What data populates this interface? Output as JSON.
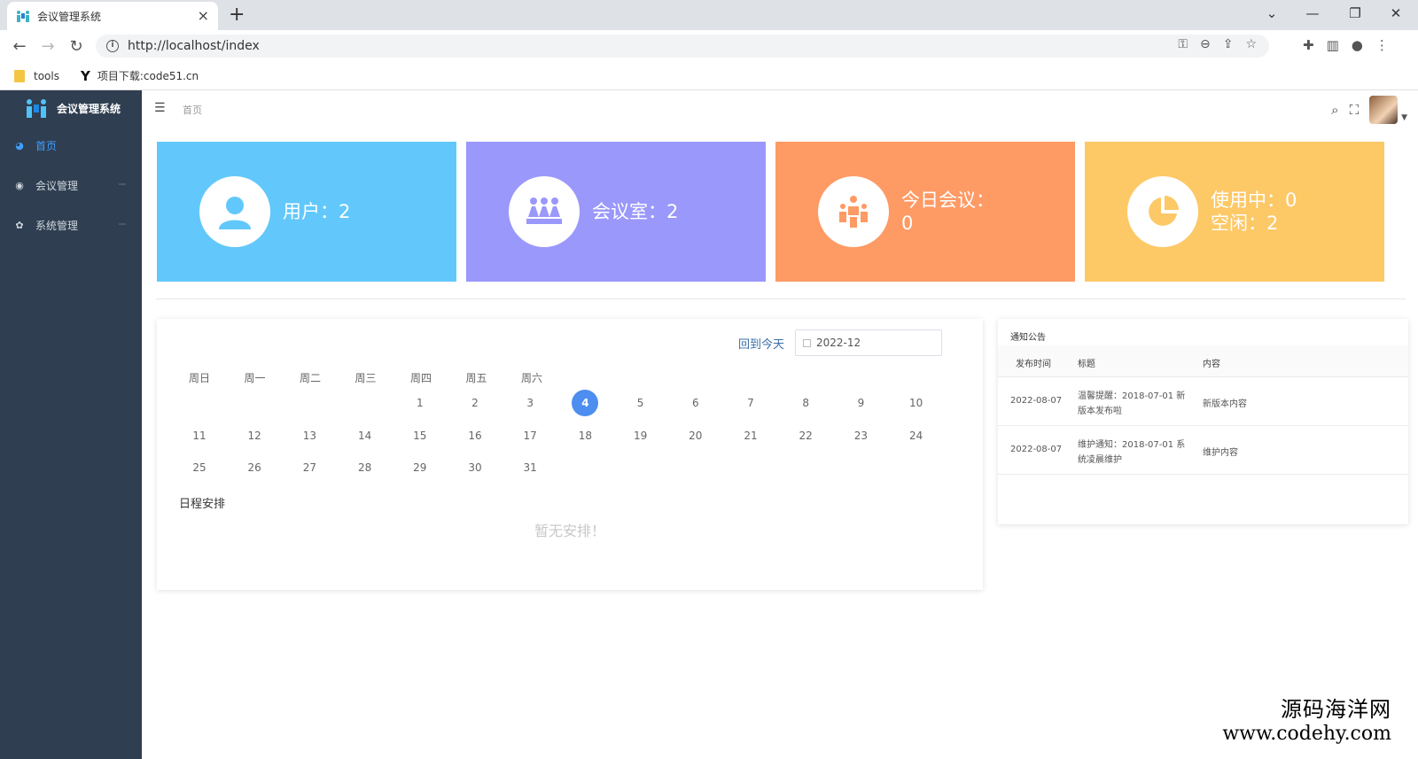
{
  "browser": {
    "tab_title": "会议管理系统",
    "tab_close": "×",
    "new_tab": "+",
    "url": "http://localhost/index",
    "bookmarks": [
      {
        "label": "tools",
        "icon": "folder-icon"
      },
      {
        "label": "项目下载:code51.cn",
        "icon": "y-logo-icon"
      }
    ],
    "window_controls": [
      "⌄",
      "—",
      "❐",
      "✕"
    ]
  },
  "app": {
    "name": "会议管理系统",
    "breadcrumb": "首页",
    "menu": [
      {
        "label": "首页",
        "icon": "dashboard-icon",
        "active": true
      },
      {
        "label": "会议管理",
        "icon": "globe-icon",
        "active": false
      },
      {
        "label": "系统管理",
        "icon": "gear-icon",
        "active": false
      }
    ]
  },
  "stats": [
    {
      "text": "用户：2",
      "color": "#62c8fb",
      "icon": "user-icon"
    },
    {
      "text": "会议室：2",
      "color": "#9a98fb",
      "icon": "meeting-room-icon"
    },
    {
      "text": "今日会议：0",
      "line1": "今日会议：",
      "line2": "0",
      "color": "#fe9a64",
      "icon": "meeting-today-icon"
    },
    {
      "line1": "使用中：0",
      "line2": "空闲：2",
      "color": "#fdc866",
      "icon": "pie-chart-icon"
    }
  ],
  "calendar": {
    "today_link": "回到今天",
    "month": "2022-12",
    "weekdays": [
      "周日",
      "周一",
      "周二",
      "周三",
      "周四",
      "周五",
      "周六"
    ],
    "today": 4,
    "rows": [
      [
        "",
        "",
        "",
        "",
        "1",
        "2",
        "3",
        "4",
        "5",
        "6",
        "7",
        "8",
        "9",
        "10"
      ],
      [
        "11",
        "12",
        "13",
        "14",
        "15",
        "16",
        "17",
        "18",
        "19",
        "20",
        "21",
        "22",
        "23",
        "24"
      ],
      [
        "25",
        "26",
        "27",
        "28",
        "29",
        "30",
        "31"
      ]
    ],
    "schedule_title": "日程安排",
    "empty_text": "暂无安排！"
  },
  "notices": {
    "title": "通知公告",
    "headers": [
      "发布时间",
      "标题",
      "内容"
    ],
    "rows": [
      {
        "date": "2022-08-07",
        "title": "温馨提醒：2018-07-01 新版本发布啦",
        "content": "新版本内容"
      },
      {
        "date": "2022-08-07",
        "title": "维护通知：2018-07-01 系统凌晨维护",
        "content": "维护内容"
      }
    ]
  },
  "watermark": {
    "line1": "源码海洋网",
    "line2": "www.codehy.com"
  }
}
